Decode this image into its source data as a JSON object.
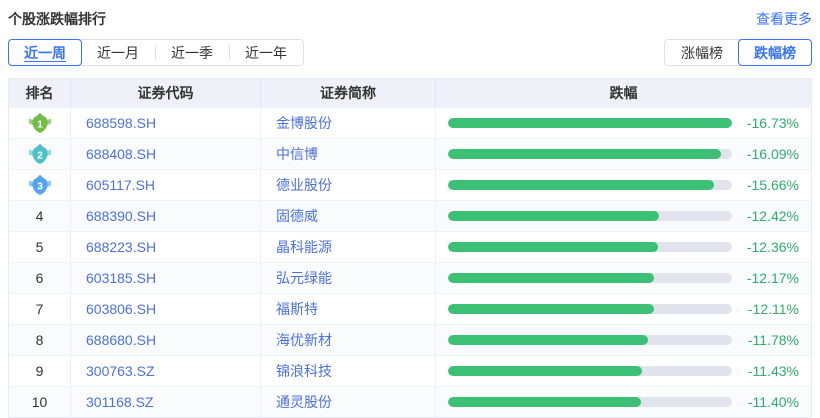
{
  "header": {
    "title": "个股涨跌幅排行",
    "more_link": "查看更多"
  },
  "period_tabs": {
    "items": [
      {
        "label": "近一周",
        "active": true
      },
      {
        "label": "近一月",
        "active": false
      },
      {
        "label": "近一季",
        "active": false
      },
      {
        "label": "近一年",
        "active": false
      }
    ]
  },
  "type_tabs": {
    "items": [
      {
        "label": "涨幅榜",
        "active": false
      },
      {
        "label": "跌幅榜",
        "active": true
      }
    ]
  },
  "table": {
    "columns": [
      "排名",
      "证券代码",
      "证券简称",
      "跌幅"
    ],
    "max_abs_change_pct": 16.73,
    "rows": [
      {
        "rank": 1,
        "code": "688598.SH",
        "name": "金博股份",
        "change": "-16.73%",
        "pct": 16.73
      },
      {
        "rank": 2,
        "code": "688408.SH",
        "name": "中信博",
        "change": "-16.09%",
        "pct": 16.09
      },
      {
        "rank": 3,
        "code": "605117.SH",
        "name": "德业股份",
        "change": "-15.66%",
        "pct": 15.66
      },
      {
        "rank": 4,
        "code": "688390.SH",
        "name": "固德威",
        "change": "-12.42%",
        "pct": 12.42
      },
      {
        "rank": 5,
        "code": "688223.SH",
        "name": "晶科能源",
        "change": "-12.36%",
        "pct": 12.36
      },
      {
        "rank": 6,
        "code": "603185.SH",
        "name": "弘元绿能",
        "change": "-12.17%",
        "pct": 12.17
      },
      {
        "rank": 7,
        "code": "603806.SH",
        "name": "福斯特",
        "change": "-12.11%",
        "pct": 12.11
      },
      {
        "rank": 8,
        "code": "688680.SH",
        "name": "海优新材",
        "change": "-11.78%",
        "pct": 11.78
      },
      {
        "rank": 9,
        "code": "300763.SZ",
        "name": "锦浪科技",
        "change": "-11.43%",
        "pct": 11.43
      },
      {
        "rank": 10,
        "code": "301168.SZ",
        "name": "通灵股份",
        "change": "-11.40%",
        "pct": 11.4
      }
    ]
  },
  "rank_badges": [
    {
      "rank": 1,
      "main": "#72bd45",
      "wing": "#9ed077"
    },
    {
      "rank": 2,
      "main": "#4fc0c9",
      "wing": "#8adde2"
    },
    {
      "rank": 3,
      "main": "#54a4ee",
      "wing": "#90c6f5"
    }
  ],
  "colors": {
    "accent_blue": "#3875f6",
    "stock_link_blue": "#4b72dc",
    "bar_green": "#3cc076",
    "value_green": "#2ead6e",
    "bar_track_gray": "#e2e4ed",
    "header_row_bg": "#eff1f8"
  }
}
